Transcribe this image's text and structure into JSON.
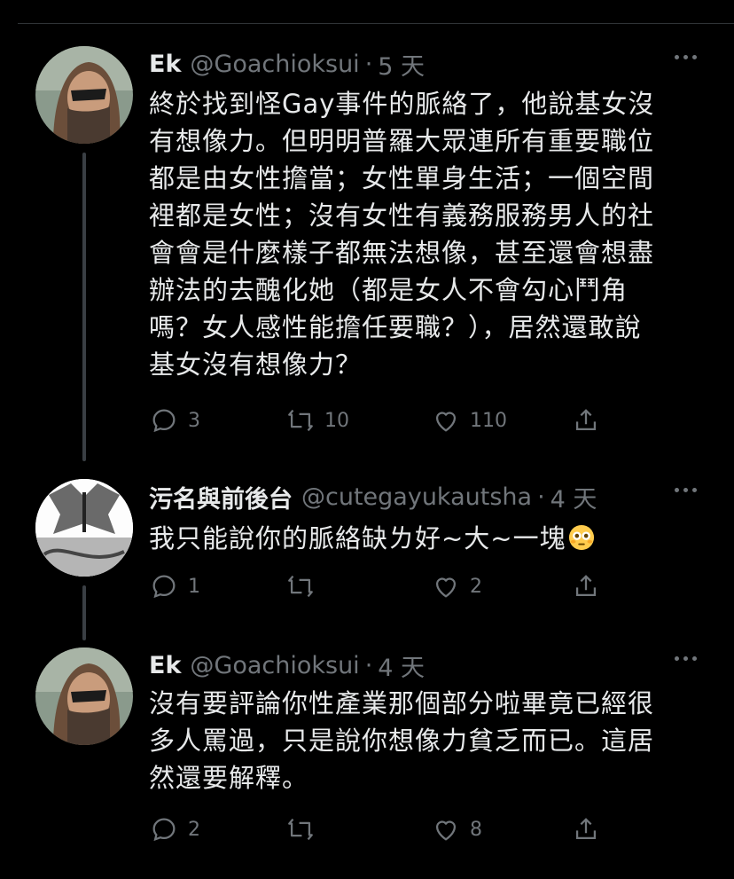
{
  "tweets": [
    {
      "name": "Ek",
      "handle": "@Goachioksui",
      "time": "5 天",
      "lines": [
        "終於找到怪Gay事件的脈絡了，他說基女沒",
        "有想像力。但明明普羅大眾連所有重要職位",
        "都是由女性擔當；女性單身生活；一個空間",
        "裡都是女性；沒有女性有義務服務男人的社",
        "會會是什麼樣子都無法想像，甚至還會想盡",
        "辦法的去醜化她（都是女人不會勾心鬥角",
        "嗎？女人感性能擔任要職？），居然還敢說",
        "基女沒有想像力？"
      ],
      "replies": "3",
      "retweets": "10",
      "likes": "110"
    },
    {
      "name": "污名與前後台",
      "handle": "@cutegayukautsha",
      "time": "4 天",
      "lines": [
        "我只能說你的脈絡缺ㄌ好~大~一塊"
      ],
      "emoji": "flushed-face",
      "replies": "1",
      "retweets": "",
      "likes": "2"
    },
    {
      "name": "Ek",
      "handle": "@Goachioksui",
      "time": "4 天",
      "lines": [
        "沒有要評論你性產業那個部分啦畢竟已經很",
        "多人罵過，只是說你想像力貧乏而已。這居",
        "然還要解釋。"
      ],
      "replies": "2",
      "retweets": "",
      "likes": "8"
    }
  ],
  "colors": {
    "background": "#000000",
    "text": "#e7e9ea",
    "muted": "#71767b",
    "divider": "#2f3336"
  }
}
